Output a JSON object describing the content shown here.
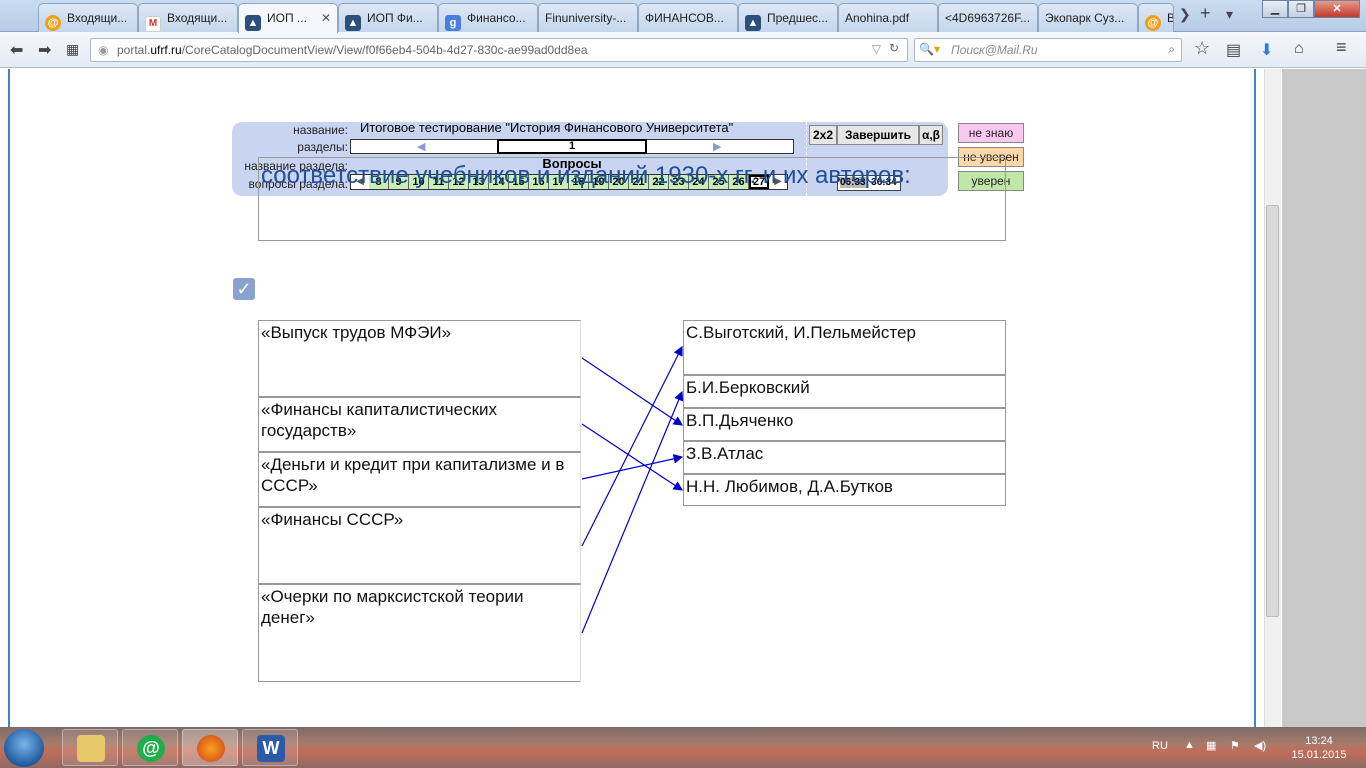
{
  "browser": {
    "tabs": [
      {
        "label": "Входящи...",
        "icon": "mail-icon",
        "active": false
      },
      {
        "label": "Входящи...",
        "icon": "gmail-icon",
        "active": false
      },
      {
        "label": "ИОП ...",
        "icon": "graduation-cap-icon",
        "active": true
      },
      {
        "label": "ИОП Фи...",
        "icon": "graduation-cap-icon",
        "active": false
      },
      {
        "label": "Финансо...",
        "icon": "google-icon",
        "active": false
      },
      {
        "label": "Finuniversity-...",
        "icon": "",
        "active": false
      },
      {
        "label": "ФИНАНСОВ...",
        "icon": "",
        "active": false
      },
      {
        "label": "Предшес...",
        "icon": "graduation-cap-icon",
        "active": false
      },
      {
        "label": "Anohina.pdf",
        "icon": "",
        "active": false
      },
      {
        "label": "<4D6963726F...",
        "icon": "",
        "active": false
      },
      {
        "label": "Экопарк Суз...",
        "icon": "",
        "active": false
      },
      {
        "label": "В",
        "icon": "mail-icon",
        "active": false
      }
    ],
    "url_prefix": "portal.",
    "url_host": "ufrf.ru",
    "url_path": "/CoreCatalogDocumentView/View/f0f66eb4-504b-4d27-830c-ae99ad0dd8ea",
    "search_placeholder": "Поиск@Mail.Ru"
  },
  "test": {
    "label_name": "название:",
    "name": "Итоговое тестирование \"История Финансового Университета\"",
    "label_sections": "разделы:",
    "current_section": "1",
    "label_section_name": "название раздела:",
    "section_name": "Вопросы",
    "label_section_questions": "вопросы раздела:",
    "questions": [
      "8",
      "9",
      "10",
      "11",
      "12",
      "13",
      "14",
      "15",
      "16",
      "17",
      "18",
      "19",
      "20",
      "21",
      "22",
      "23",
      "24",
      "25",
      "26",
      "27"
    ],
    "current_question": "27",
    "btn_2x2": "2x2",
    "btn_finish": "Завершить",
    "btn_ab": "α,β",
    "timer_elapsed": "06:33",
    "timer_total": "36:34",
    "btn_dont_know": "не знаю",
    "btn_not_sure": "не уверен",
    "btn_sure": "уверен"
  },
  "question": {
    "text": "соответствие учебников и изданий 1930-х гг. и их авторов:",
    "left_items": [
      "«Выпуск трудов МФЭИ»",
      "«Финансы капиталистических государств»",
      "«Деньги и кредит при  капитализме и в СССР»",
      "«Финансы СССР»",
      "«Очерки по марксистской теории денег»"
    ],
    "right_items": [
      "С.Выготский, И.Пельмейстер",
      " Б.И.Берковский",
      "В.П.Дьяченко",
      "З.В.Атлас",
      "Н.Н. Любимов, Д.А.Бутков"
    ],
    "links": [
      {
        "from": 0,
        "to": 2
      },
      {
        "from": 1,
        "to": 4
      },
      {
        "from": 2,
        "to": 3
      },
      {
        "from": 3,
        "to": 0
      },
      {
        "from": 4,
        "to": 1
      }
    ],
    "link_color": "#0000cc"
  },
  "taskbar": {
    "language": "RU",
    "time": "13:24",
    "date": "15.01.2015"
  }
}
